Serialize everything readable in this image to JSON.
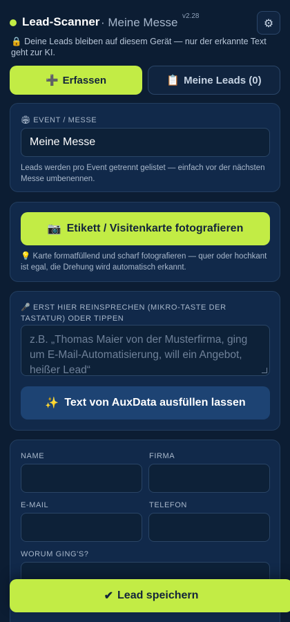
{
  "header": {
    "app_name": "Lead-Scanner",
    "event_sub": "· Meine Messe",
    "version": "v2.28",
    "settings_icon": "⚙",
    "privacy_icon": "🔒",
    "privacy_text": "Deine Leads bleiben auf diesem Gerät — nur der erkannte Text geht zur KI."
  },
  "tabs": [
    {
      "icon": "➕",
      "label": "Erfassen",
      "active": true
    },
    {
      "icon": "📋",
      "label": "Meine Leads (0)",
      "active": false
    }
  ],
  "event": {
    "icon": "🏟",
    "label": "EVENT / MESSE",
    "value": "Meine Messe",
    "hint": "Leads werden pro Event getrennt gelistet — einfach vor der nächsten Messe umbenennen."
  },
  "photo": {
    "button_icon": "📷",
    "button_label": "Etikett / Visitenkarte fotografieren",
    "hint_icon": "💡",
    "hint": "Karte formatfüllend und scharf fotografieren — quer oder hochkant ist egal, die Drehung wird automatisch erkannt."
  },
  "voice": {
    "icon": "🎤",
    "label": "ERST HIER REINSPRECHEN (MIKRO-TASTE DER TASTATUR) ODER TIPPEN",
    "placeholder": "z.B. „Thomas Maier von der Musterfirma, ging um E-Mail-Automatisierung, will ein Angebot, heißer Lead“",
    "ai_button_icon": "✨",
    "ai_button_label": "Text von AuxData ausfüllen lassen"
  },
  "form": {
    "name_label": "NAME",
    "company_label": "FIRMA",
    "email_label": "E-MAIL",
    "phone_label": "TELEFON",
    "topic_label": "WORUM GING'S?"
  },
  "save": {
    "icon": "✔",
    "label": "Lead speichern"
  },
  "colors": {
    "accent": "#c2ec45",
    "background": "#0c1d33",
    "card": "#11294a",
    "secondary_button": "#1d4373"
  }
}
